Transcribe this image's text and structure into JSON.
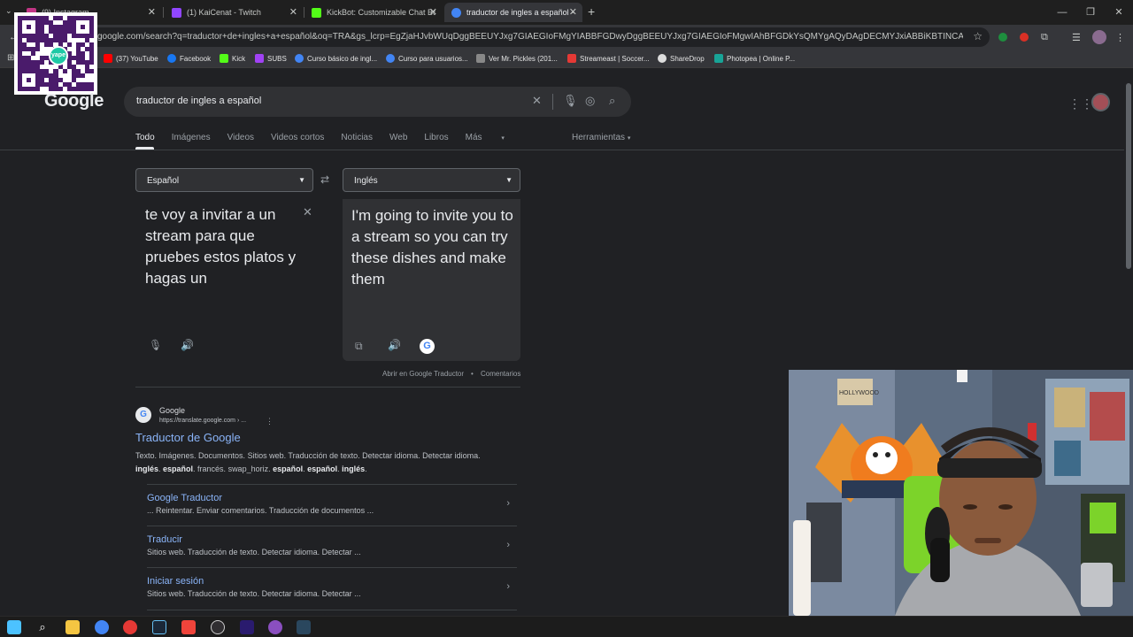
{
  "browser": {
    "tabs": [
      {
        "title": "(9) Instagram",
        "favicon_color": "#c13584"
      },
      {
        "title": "(1) KaiCenat - Twitch",
        "favicon_color": "#9146ff"
      },
      {
        "title": "KickBot: Customizable Chat Bot",
        "favicon_color": "#53fc18"
      },
      {
        "title": "traductor de ingles a español -",
        "favicon_color": "#4285f4"
      }
    ],
    "url": "google.com/search?q=traductor+de+ingles+a+español&oq=TRA&gs_lcrp=EgZjaHJvbWUqDggBEEUYJxg7GIAEGIoFMgYIABBFGDwyDggBEEUYJxg7GIAEGIoFMgwIAhBFGDkYsQMYgAQyDAgDECMYJxiABBiKBTINCAQQABiDARixAxiABDIGCA..."
  },
  "bookmarks": [
    {
      "label": "(37) YouTube",
      "color": "#ff0000"
    },
    {
      "label": "Facebook",
      "color": "#1877f2"
    },
    {
      "label": "Kick",
      "color": "#53fc18"
    },
    {
      "label": "SUBS",
      "color": "#a142f4"
    },
    {
      "label": "Curso básico de ingl...",
      "color": "#4285f4"
    },
    {
      "label": "Curso para usuarios...",
      "color": "#4285f4"
    },
    {
      "label": "Ver Mr. Pickles (201...",
      "color": "#888888"
    },
    {
      "label": "Streameast | Soccer...",
      "color": "#e53935"
    },
    {
      "label": "ShareDrop",
      "color": "#dddddd"
    },
    {
      "label": "Photopea | Online P...",
      "color": "#18a497"
    }
  ],
  "overlay": {
    "qr_badge": "yape"
  },
  "google": {
    "logo": "Google",
    "query": "traductor de ingles a español",
    "tabs": [
      "Todo",
      "Imágenes",
      "Videos",
      "Videos cortos",
      "Noticias",
      "Web",
      "Libros",
      "Más"
    ],
    "tools": "Herramientas"
  },
  "translator": {
    "source_lang": "Español",
    "target_lang": "Inglés",
    "source_text": "te voy a invitar a un stream para que pruebes estos platos y hagas un",
    "target_text": "I'm going to invite you to a stream so you can try these dishes and make them",
    "open_link": "Abrir en Google Traductor",
    "feedback": "Comentarios"
  },
  "result": {
    "site_name": "Google",
    "site_url": "https://translate.google.com › ...",
    "title": "Traductor de Google",
    "snippet_line1": "Texto. Imágenes. Documentos. Sitios web. Traducción de texto. Detectar idioma. Detectar idioma.",
    "snippet_line2_parts": [
      "inglés",
      ". ",
      "español",
      ". francés. swap_horiz. ",
      "español",
      ". ",
      "español",
      ". ",
      "inglés",
      "."
    ],
    "sitelinks": [
      {
        "title": "Google Traductor",
        "desc": "... Reintentar. Enviar comentarios. Traducción de documentos ..."
      },
      {
        "title": "Traducir",
        "desc": "Sitios web. Traducción de texto. Detectar idioma. Detectar ..."
      },
      {
        "title": "Iniciar sesión",
        "desc": "Sitios web. Traducción de texto. Detectar idioma. Detectar ..."
      }
    ]
  },
  "webcam": {
    "sign_text": "HOLLYWOOD"
  },
  "taskbar": [
    {
      "name": "windows-start",
      "color": "#4cc2ff"
    },
    {
      "name": "search",
      "color": "#ffffff"
    },
    {
      "name": "file-explorer",
      "color": "#f4c542"
    },
    {
      "name": "chrome",
      "color": "#4285f4"
    },
    {
      "name": "media-player",
      "color": "#e53935"
    },
    {
      "name": "steam",
      "color": "#1b2838"
    },
    {
      "name": "anydesk",
      "color": "#ef443b"
    },
    {
      "name": "obs",
      "color": "#302e31"
    },
    {
      "name": "premiere",
      "color": "#2a1b6e"
    },
    {
      "name": "chrome-profile",
      "color": "#8a4fbf"
    },
    {
      "name": "steam-2",
      "color": "#2a475e"
    }
  ]
}
